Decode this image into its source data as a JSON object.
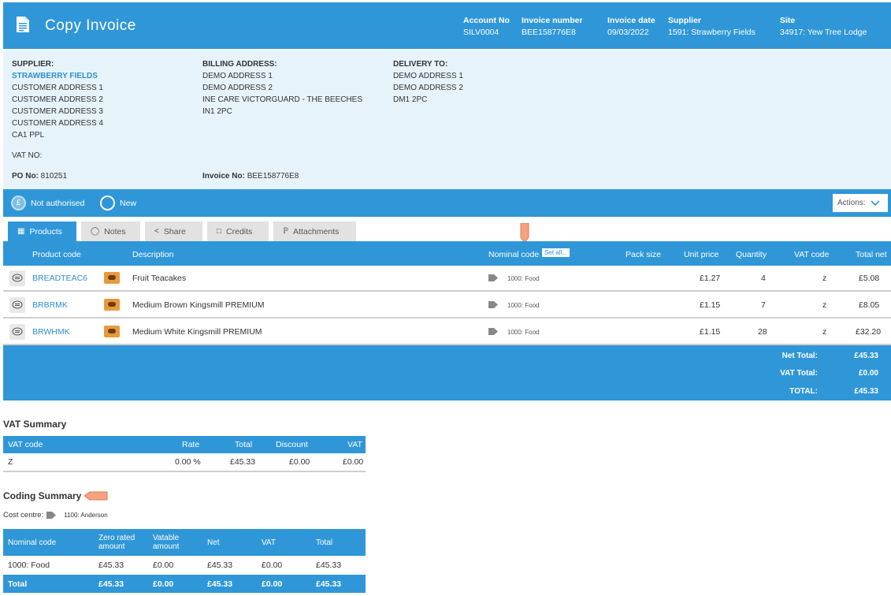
{
  "header": {
    "title": "Copy Invoice",
    "fields": [
      {
        "label": "Account No",
        "value": "SILV0004"
      },
      {
        "label": "Invoice number",
        "value": "BEE158776E8"
      },
      {
        "label": "Invoice date",
        "value": "09/03/2022"
      },
      {
        "label": "Supplier",
        "value": "1591: Strawberry Fields"
      },
      {
        "label": "Site",
        "value": "34917: Yew Tree Lodge"
      }
    ]
  },
  "addresses": {
    "supplier_label": "SUPPLIER:",
    "supplier_name": "STRAWBERRY FIELDS",
    "supplier_lines": [
      "CUSTOMER ADDRESS 1",
      "CUSTOMER ADDRESS 2",
      "CUSTOMER ADDRESS 3",
      "CUSTOMER ADDRESS 4",
      "CA1 PPL"
    ],
    "billing_label": "BILLING ADDRESS:",
    "billing_lines": [
      "DEMO ADDRESS 1",
      "DEMO ADDRESS 2",
      "INE CARE VICTORGUARD - THE BEECHES",
      "IN1 2PC"
    ],
    "delivery_label": "DELIVERY TO:",
    "delivery_lines": [
      "DEMO ADDRESS 1",
      "DEMO ADDRESS 2",
      "DM1 2PC"
    ],
    "vat_no": "VAT NO:",
    "po_label": "PO No:",
    "po_value": "810251",
    "invoice_label": "Invoice No:",
    "invoice_value": "BEE158776E8"
  },
  "status": {
    "authorised": "Not authorised",
    "state": "New",
    "actions": "Actions:"
  },
  "tabs": [
    {
      "label": "Products",
      "icon": "box-icon"
    },
    {
      "label": "Notes",
      "icon": "chat-icon"
    },
    {
      "label": "Share",
      "icon": "share-icon"
    },
    {
      "label": "Credits",
      "icon": "doc-icon"
    },
    {
      "label": "Attachments",
      "icon": "paperclip-icon"
    }
  ],
  "products": {
    "columns": {
      "code": "Product code",
      "description": "Description",
      "nominal": "Nominal code",
      "set_all": "Set all...",
      "pack": "Pack size",
      "unit": "Unit price",
      "qty": "Quantity",
      "vat": "VAT code",
      "total": "Total net"
    },
    "rows": [
      {
        "code": "BREADTEAC6",
        "description": "Fruit Teacakes",
        "nominal": "1000: Food",
        "unit": "£1.27",
        "qty": "4",
        "vat": "z",
        "total": "£5.08"
      },
      {
        "code": "BRBRMK",
        "description": "Medium Brown Kingsmill PREMIUM",
        "nominal": "1000: Food",
        "unit": "£1.15",
        "qty": "7",
        "vat": "z",
        "total": "£8.05"
      },
      {
        "code": "BRWHMK",
        "description": "Medium White Kingsmill PREMIUM",
        "nominal": "1000: Food",
        "unit": "£1.15",
        "qty": "28",
        "vat": "z",
        "total": "£32.20"
      }
    ]
  },
  "totals": {
    "net_label": "Net Total:",
    "net": "£45.33",
    "vat_label": "VAT Total:",
    "vat": "£0.00",
    "total_label": "TOTAL:",
    "total": "£45.33"
  },
  "vat_summary": {
    "title": "VAT Summary",
    "columns": [
      "VAT code",
      "Rate",
      "Total",
      "Discount",
      "VAT"
    ],
    "row": [
      "Z",
      "0.00 %",
      "£45.33",
      "£0.00",
      "£0.00"
    ]
  },
  "coding_summary": {
    "title": "Coding Summary",
    "cost_centre_label": "Cost centre:",
    "cost_centre_value": "1100: Anderson",
    "columns": [
      "Nominal code",
      "Zero rated amount",
      "Vatable amount",
      "Net",
      "VAT",
      "Total"
    ],
    "col_zero_1": "Zero rated",
    "col_zero_2": "amount",
    "col_vatable_1": "Vatable",
    "col_vatable_2": "amount",
    "row": [
      "1000: Food",
      "£45.33",
      "£0.00",
      "£45.33",
      "£0.00",
      "£45.33"
    ],
    "total_row": [
      "Total",
      "£45.33",
      "£0.00",
      "£45.33",
      "£0.00",
      "£45.33"
    ]
  },
  "colors": {
    "primary": "#2f97d8",
    "panel": "#e6f3fb",
    "link": "#2f8fd0",
    "annotation_arrow": "#f4a27f"
  }
}
